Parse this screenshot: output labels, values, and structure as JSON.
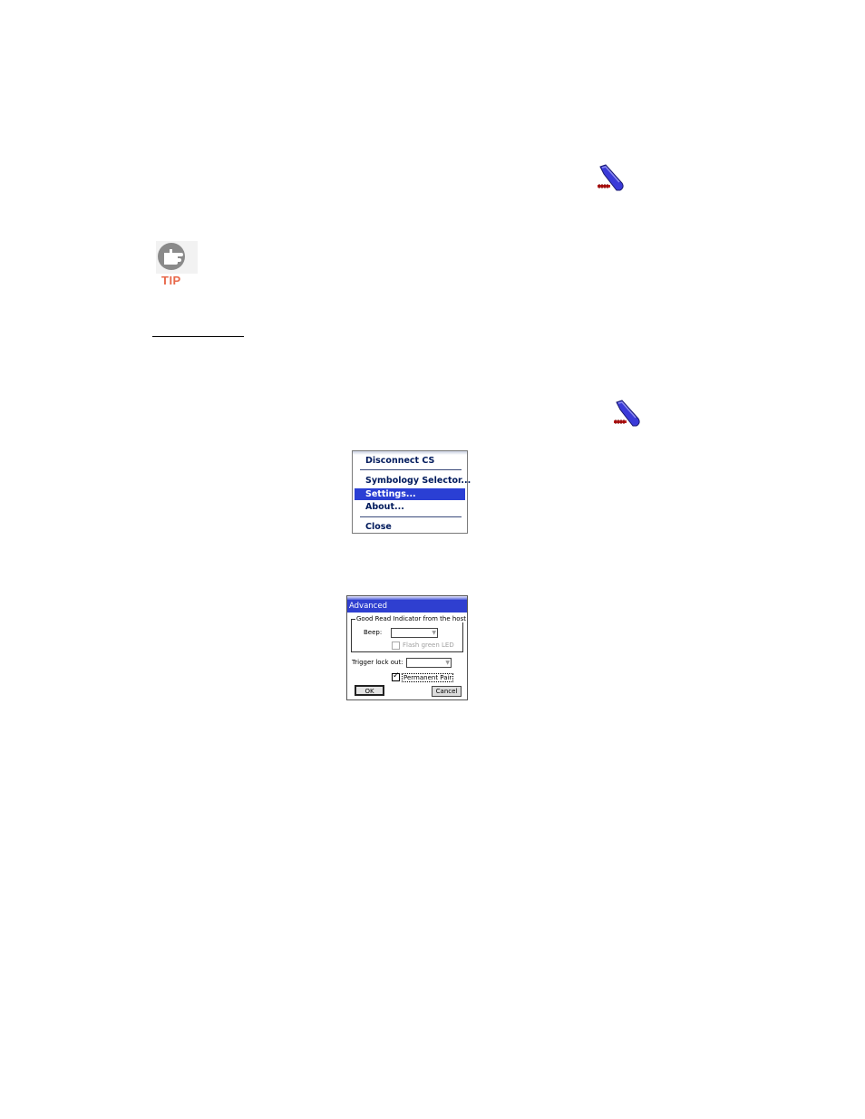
{
  "icons": {
    "scanner_top": "scanner-icon",
    "scanner_bottom": "scanner-icon",
    "tip": "hand-pointing-icon"
  },
  "tip": {
    "label": "TIP",
    "color": "#e8684a"
  },
  "menu": {
    "items": [
      {
        "label": "Disconnect CS",
        "selected": false
      },
      {
        "label": "Symbology Selector...",
        "selected": false
      },
      {
        "label": "Settings...",
        "selected": true
      },
      {
        "label": "About...",
        "selected": false
      },
      {
        "label": "Close",
        "selected": false
      }
    ],
    "selected_color": "#2a3fd4"
  },
  "dialog": {
    "title": "Advanced",
    "title_color": "#2f3fd0",
    "group_label": "Good Read Indicator from the host",
    "beep_label": "Beep:",
    "beep_value": "",
    "flash_led_label": "Flash green LED",
    "flash_led_checked": false,
    "trigger_lockout_label": "Trigger lock out:",
    "trigger_lockout_value": "",
    "permanent_pair_label": "Permanent Pair",
    "permanent_pair_checked": true,
    "ok_label": "OK",
    "cancel_label": "Cancel"
  }
}
